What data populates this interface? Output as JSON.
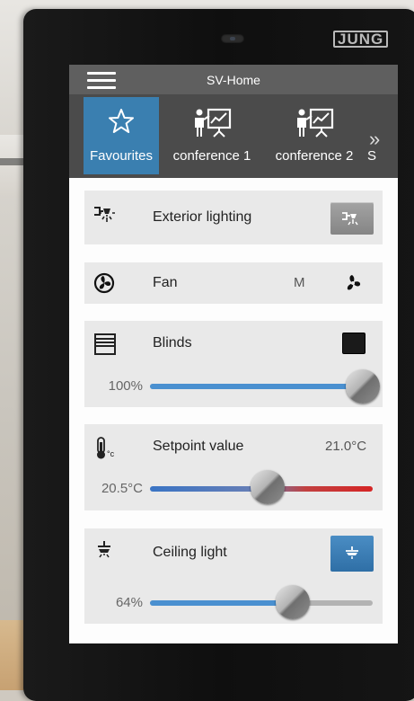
{
  "device": {
    "brand": "JUNG"
  },
  "header": {
    "title": "SV-Home"
  },
  "tabs": [
    {
      "label": "Favourites",
      "icon": "star-icon",
      "active": true
    },
    {
      "label": "conference 1",
      "icon": "presentation-icon",
      "active": false
    },
    {
      "label": "conference 2",
      "icon": "presentation-icon",
      "active": false
    },
    {
      "label": "S",
      "icon": "",
      "active": false
    }
  ],
  "more_icon": "»",
  "items": {
    "exterior": {
      "label": "Exterior lighting",
      "icon": "exterior-light-icon"
    },
    "fan": {
      "label": "Fan",
      "mode": "M",
      "icon": "fan-icon"
    },
    "blinds": {
      "label": "Blinds",
      "value_text": "100%",
      "value": 1.0,
      "icon": "blinds-icon"
    },
    "setpoint": {
      "label": "Setpoint value",
      "setpoint_text": "21.0°C",
      "current_text": "20.5°C",
      "position": 0.53,
      "icon": "thermometer-icon"
    },
    "ceiling": {
      "label": "Ceiling light",
      "value_text": "64%",
      "value": 0.64,
      "icon": "ceiling-light-icon"
    }
  },
  "colors": {
    "accent": "#3a7fb0",
    "slider_blue": "#4a90d0",
    "slider_red": "#d02a2a",
    "track_gray": "#b3b3b3"
  }
}
